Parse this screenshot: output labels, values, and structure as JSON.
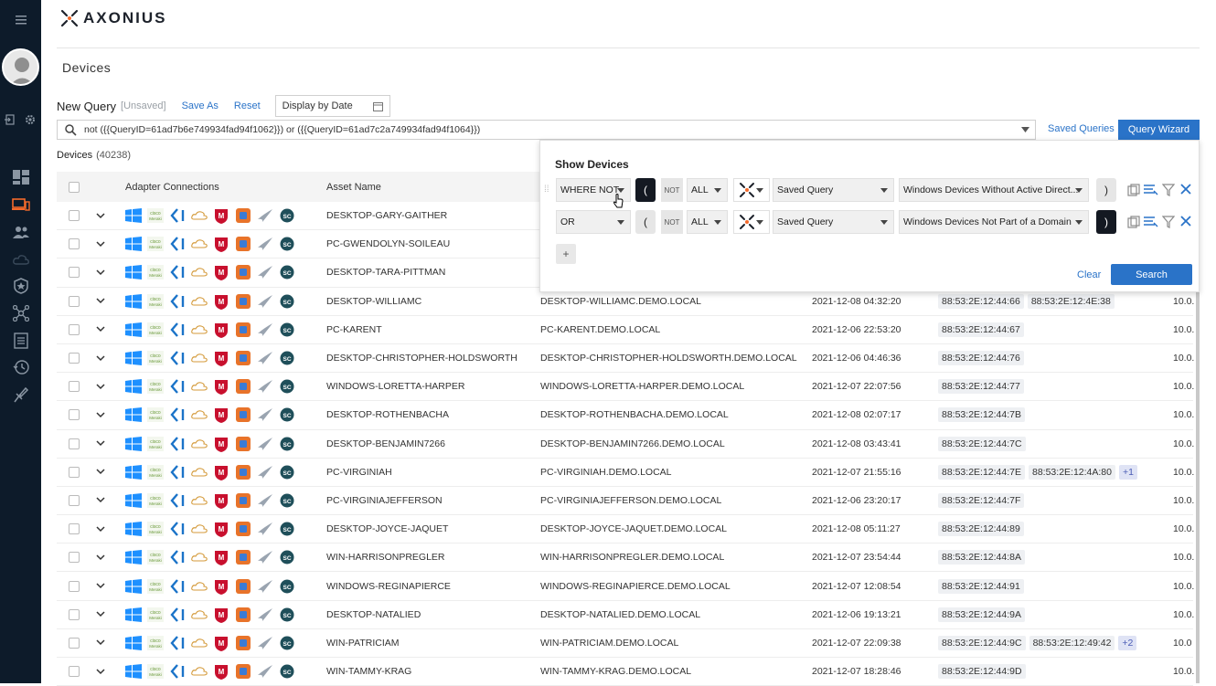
{
  "app": {
    "logo_text": "AXONIUS",
    "page_title": "Devices"
  },
  "sidebar": {
    "icons": [
      "menu-icon",
      "avatar",
      "logout-icon",
      "settings-icon",
      "dashboard-icon",
      "devices-icon",
      "users-icon",
      "cloud-icon",
      "compliance-icon",
      "adapters-icon",
      "reports-icon",
      "history-icon",
      "enforcement-icon"
    ]
  },
  "query": {
    "new_query": "New Query",
    "unsaved": "[Unsaved]",
    "save_as": "Save As",
    "reset": "Reset",
    "date_placeholder": "Display by Date",
    "search_text": "not ({{QueryID=61ad7b6e749934fad94f1062}}) or ({{QueryID=61ad7c2a749934fad94f1064}})",
    "saved_queries": "Saved Queries",
    "query_wizard": "Query Wizard"
  },
  "devices": {
    "label": "Devices",
    "count": "(40238)"
  },
  "table": {
    "headers": {
      "adapters": "Adapter Connections",
      "asset_name": "Asset Name"
    },
    "rows": [
      {
        "asset": "DESKTOP-GARY-GAITHER",
        "host": "",
        "last_seen": "",
        "macs": [],
        "extra": "",
        "ip": ""
      },
      {
        "asset": "PC-GWENDOLYN-SOILEAU",
        "host": "",
        "last_seen": "",
        "macs": [],
        "extra": "",
        "ip": ""
      },
      {
        "asset": "DESKTOP-TARA-PITTMAN",
        "host": "",
        "last_seen": "",
        "macs": [],
        "extra": "",
        "ip": ""
      },
      {
        "asset": "DESKTOP-WILLIAMC",
        "host": "DESKTOP-WILLIAMC.DEMO.LOCAL",
        "last_seen": "2021-12-08 04:32:20",
        "macs": [
          "88:53:2E:12:44:66",
          "88:53:2E:12:4E:38"
        ],
        "extra": "",
        "ip": "10.0."
      },
      {
        "asset": "PC-KARENT",
        "host": "PC-KARENT.DEMO.LOCAL",
        "last_seen": "2021-12-06 22:53:20",
        "macs": [
          "88:53:2E:12:44:67"
        ],
        "extra": "",
        "ip": "10.0."
      },
      {
        "asset": "DESKTOP-CHRISTOPHER-HOLDSWORTH",
        "host": "DESKTOP-CHRISTOPHER-HOLDSWORTH.DEMO.LOCAL",
        "last_seen": "2021-12-06 04:46:36",
        "macs": [
          "88:53:2E:12:44:76"
        ],
        "extra": "",
        "ip": "10.0."
      },
      {
        "asset": "WINDOWS-LORETTA-HARPER",
        "host": "WINDOWS-LORETTA-HARPER.DEMO.LOCAL",
        "last_seen": "2021-12-07 22:07:56",
        "macs": [
          "88:53:2E:12:44:77"
        ],
        "extra": "",
        "ip": "10.0."
      },
      {
        "asset": "DESKTOP-ROTHENBACHA",
        "host": "DESKTOP-ROTHENBACHA.DEMO.LOCAL",
        "last_seen": "2021-12-08 02:07:17",
        "macs": [
          "88:53:2E:12:44:7B"
        ],
        "extra": "",
        "ip": "10.0."
      },
      {
        "asset": "DESKTOP-BENJAMIN7266",
        "host": "DESKTOP-BENJAMIN7266.DEMO.LOCAL",
        "last_seen": "2021-12-08 03:43:41",
        "macs": [
          "88:53:2E:12:44:7C"
        ],
        "extra": "",
        "ip": "10.0."
      },
      {
        "asset": "PC-VIRGINIAH",
        "host": "PC-VIRGINIAH.DEMO.LOCAL",
        "last_seen": "2021-12-07 21:55:16",
        "macs": [
          "88:53:2E:12:44:7E",
          "88:53:2E:12:4A:80"
        ],
        "extra": "+1",
        "ip": "10.0."
      },
      {
        "asset": "PC-VIRGINIAJEFFERSON",
        "host": "PC-VIRGINIAJEFFERSON.DEMO.LOCAL",
        "last_seen": "2021-12-06 23:20:17",
        "macs": [
          "88:53:2E:12:44:7F"
        ],
        "extra": "",
        "ip": "10.0."
      },
      {
        "asset": "DESKTOP-JOYCE-JAQUET",
        "host": "DESKTOP-JOYCE-JAQUET.DEMO.LOCAL",
        "last_seen": "2021-12-08 05:11:27",
        "macs": [
          "88:53:2E:12:44:89"
        ],
        "extra": "",
        "ip": "10.0."
      },
      {
        "asset": "WIN-HARRISONPREGLER",
        "host": "WIN-HARRISONPREGLER.DEMO.LOCAL",
        "last_seen": "2021-12-07 23:54:44",
        "macs": [
          "88:53:2E:12:44:8A"
        ],
        "extra": "",
        "ip": "10.0."
      },
      {
        "asset": "WINDOWS-REGINAPIERCE",
        "host": "WINDOWS-REGINAPIERCE.DEMO.LOCAL",
        "last_seen": "2021-12-07 12:08:54",
        "macs": [
          "88:53:2E:12:44:91"
        ],
        "extra": "",
        "ip": "10.0."
      },
      {
        "asset": "DESKTOP-NATALIED",
        "host": "DESKTOP-NATALIED.DEMO.LOCAL",
        "last_seen": "2021-12-06 19:13:21",
        "macs": [
          "88:53:2E:12:44:9A"
        ],
        "extra": "",
        "ip": "10.0."
      },
      {
        "asset": "WIN-PATRICIAM",
        "host": "WIN-PATRICIAM.DEMO.LOCAL",
        "last_seen": "2021-12-07 22:09:38",
        "macs": [
          "88:53:2E:12:44:9C",
          "88:53:2E:12:49:42"
        ],
        "extra": "+2",
        "ip": "10.0"
      },
      {
        "asset": "WIN-TAMMY-KRAG",
        "host": "WIN-TAMMY-KRAG.DEMO.LOCAL",
        "last_seen": "2021-12-07 18:28:46",
        "macs": [
          "88:53:2E:12:44:9D"
        ],
        "extra": "",
        "ip": "10.0."
      }
    ]
  },
  "wizard": {
    "title": "Show Devices",
    "rows": [
      {
        "logic": "WHERE NOT",
        "not": "NOT",
        "scope": "ALL",
        "type": "Saved Query",
        "value": "Windows Devices Without Active Direct..."
      },
      {
        "logic": "OR",
        "not": "NOT",
        "scope": "ALL",
        "type": "Saved Query",
        "value": "Windows Devices Not Part of a Domain"
      }
    ],
    "add": "+",
    "clear": "Clear",
    "search": "Search"
  },
  "colors": {
    "accent": "#2a73c8",
    "sidebar": "#0d1b2a",
    "active_icon": "#f56a2b"
  }
}
